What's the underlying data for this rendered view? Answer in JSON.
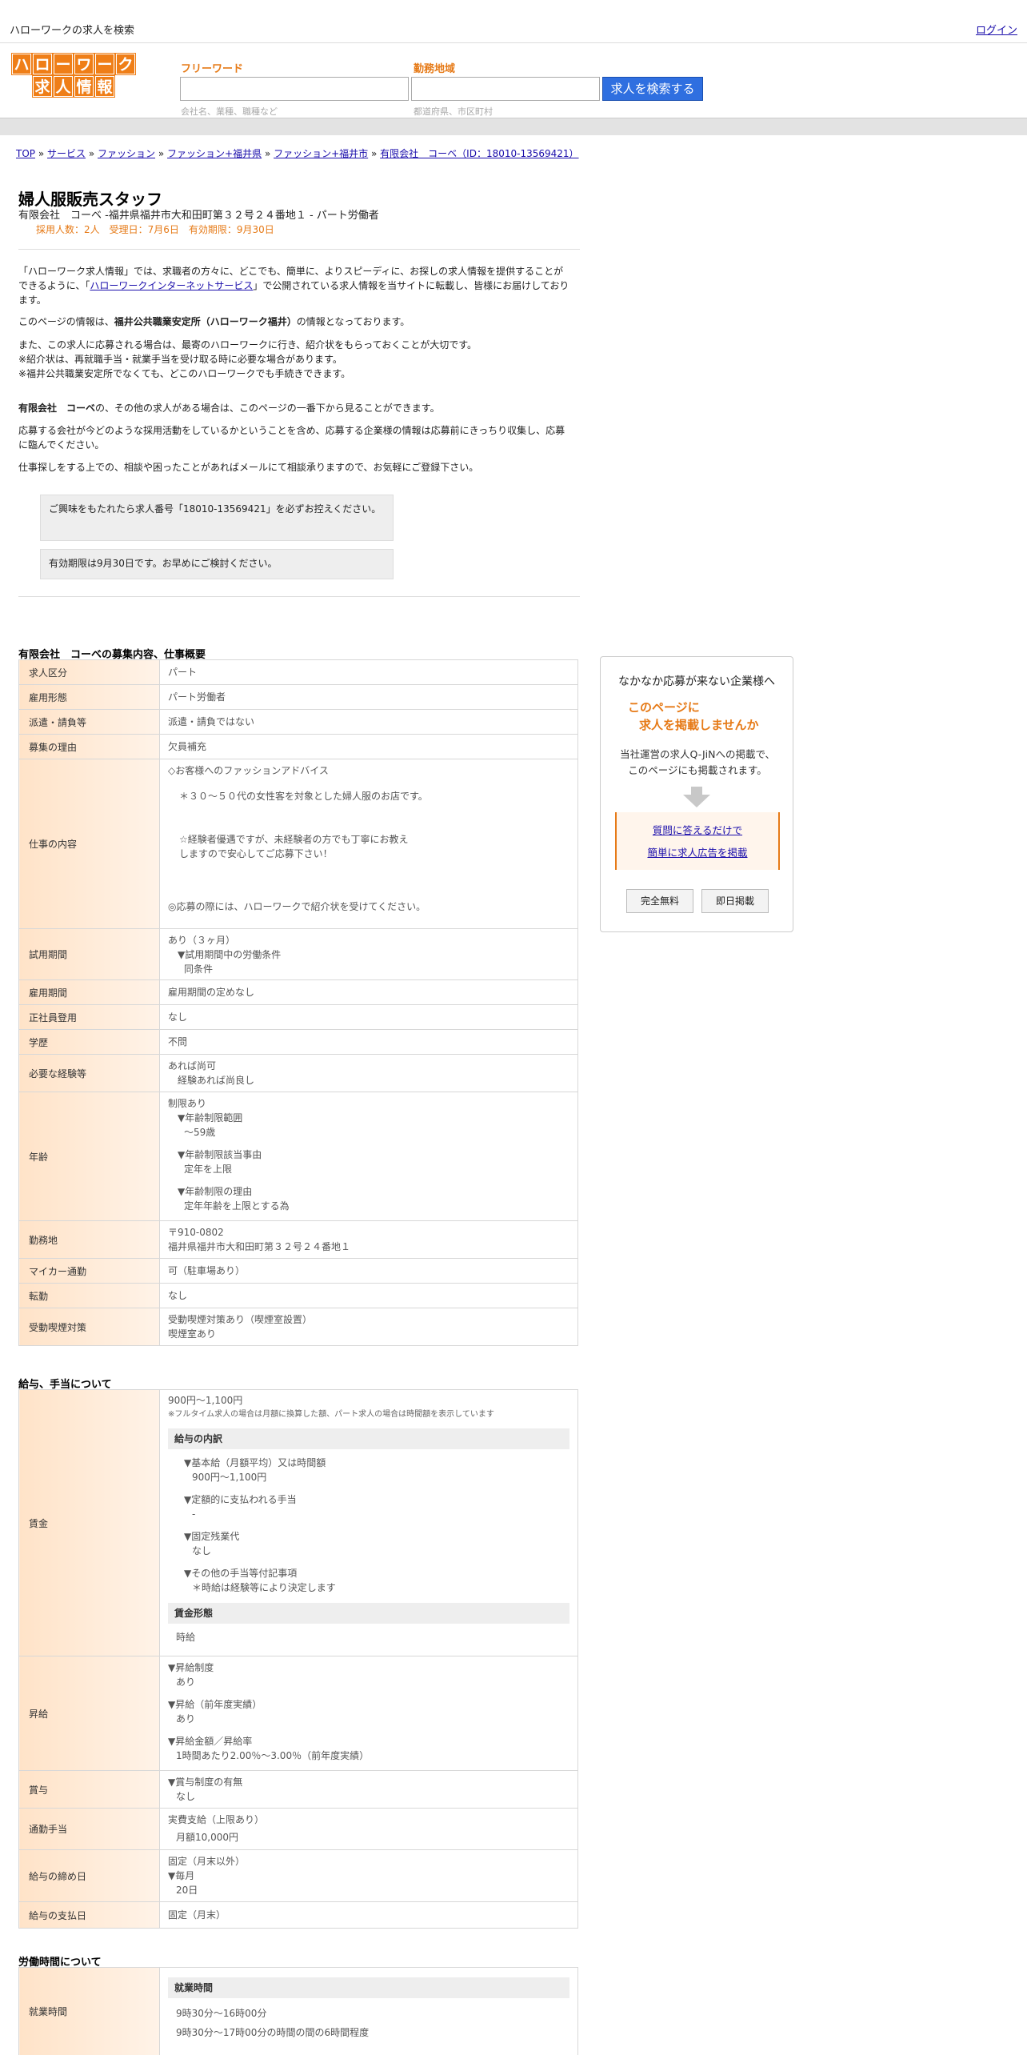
{
  "topbar": {
    "site_title": "ハローワークの求人を検索",
    "login": "ログイン"
  },
  "logo": {
    "row1": [
      "ハ",
      "ロ",
      "ー",
      "ワ",
      "ー",
      "ク"
    ],
    "row2": [
      "求",
      "人",
      "情",
      "報"
    ]
  },
  "search": {
    "freeword_label": "フリーワード",
    "freeword_hint": "会社名、業種、職種など",
    "area_label": "勤務地域",
    "area_hint": "都道府県、市区町村",
    "button": "求人を検索する"
  },
  "breadcrumb": {
    "items": [
      "TOP",
      "サービス",
      "ファッション",
      "ファッション+福井県",
      "ファッション+福井市",
      "有限会社　コーベ（ID：18010-13569421）"
    ],
    "sep": "»"
  },
  "job": {
    "title": "婦人服販売スタッフ",
    "subtitle": "有限会社　コーベ -福井県福井市大和田町第３２号２４番地１ - パート労働者",
    "meta": "採用人数：2人　受理日：7月6日　有効期限：9月30日"
  },
  "intro": {
    "p1_pre": "「ハローワーク求人情報」では、求職者の方々に、どこでも、簡単に、よりスピーディに、お探しの求人情報を提供することができるように、「",
    "p1_link": "ハローワークインターネットサービス",
    "p1_post": "」で公開されている求人情報を当サイトに転載し、皆様にお届けしております。",
    "p2_pre": "このページの情報は、",
    "p2_bold": "福井公共職業安定所（ハローワーク福井）",
    "p2_post": "の情報となっております。",
    "p3": "また、この求人に応募される場合は、最寄のハローワークに行き、紹介状をもらっておくことが大切です。",
    "p4": "※紹介状は、再就職手当・就業手当を受け取る時に必要な場合があります。",
    "p5": "※福井公共職業安定所でなくても、どこのハローワークでも手続きできます。",
    "p6_bold": "有限会社　コーベ",
    "p6_post": "の、その他の求人がある場合は、このページの一番下から見ることができます。",
    "p7": "応募する会社が今どのような採用活動をしているかということを含め、応募する企業様の情報は応募前にきっちり収集し、応募に臨んでください。",
    "p8": "仕事探しをする上での、相談や困ったことがあればメールにて相談承りますので、お気軽にご登録下さい。"
  },
  "notices": {
    "n1": "ご興味をもたれたら求人番号「18010-13569421」を必ずお控えください。",
    "n2": "有効期限は9月30日です。お早めにご検討ください。"
  },
  "sec1": {
    "title": "有限会社　コーベの募集内容、仕事概要",
    "rows": {
      "kyujin_kubun": {
        "label": "求人区分",
        "value": "パート"
      },
      "koyo_keitai": {
        "label": "雇用形態",
        "value": "パート労働者"
      },
      "haken": {
        "label": "派遣・請負等",
        "value": "派遣・請負ではない"
      },
      "riyu": {
        "label": "募集の理由",
        "value": "欠員補充"
      },
      "shigoto": {
        "label": "仕事の内容",
        "l1": "◇お客様へのファッションアドバイス",
        "l2": "＊３０～５０代の女性客を対象とした婦人服のお店です。",
        "l3": "☆経験者優遇ですが、未経験者の方でも丁寧にお教え",
        "l4": "しますので安心してご応募下さい！",
        "l5": "◎応募の際には、ハローワークで紹介状を受けてください。"
      },
      "shiyo": {
        "label": "試用期間",
        "l1": "あり（３ヶ月）",
        "l2": "▼試用期間中の労働条件",
        "l3": "同条件"
      },
      "koyo_kikan": {
        "label": "雇用期間",
        "value": "雇用期間の定めなし"
      },
      "seishain": {
        "label": "正社員登用",
        "value": "なし"
      },
      "gakureki": {
        "label": "学歴",
        "value": "不問"
      },
      "keiken": {
        "label": "必要な経験等",
        "l1": "あれば尚可",
        "l2": "経験あれば尚良し"
      },
      "nenrei": {
        "label": "年齢",
        "l1": "制限あり",
        "l2": "▼年齢制限範囲",
        "l3": "〜59歳",
        "l4": "▼年齢制限該当事由",
        "l5": "定年を上限",
        "l6": "▼年齢制限の理由",
        "l7": "定年年齢を上限とする為"
      },
      "kinmuchi": {
        "label": "勤務地",
        "l1": "〒910-0802",
        "l2": "福井県福井市大和田町第３２号２４番地１"
      },
      "mycar": {
        "label": "マイカー通勤",
        "value": "可（駐車場あり）"
      },
      "tenkin": {
        "label": "転勤",
        "value": "なし"
      },
      "kitsuen": {
        "label": "受動喫煙対策",
        "l1": "受動喫煙対策あり（喫煙室設置）",
        "l2": "喫煙室あり"
      }
    }
  },
  "sec2": {
    "title": "給与、手当について",
    "chingin": {
      "label": "賃金",
      "amount": "900円〜1,100円",
      "note": "※フルタイム求人の場合は月額に換算した額、パート求人の場合は時間額を表示しています",
      "breakdown_head": "給与の内訳",
      "b1": "▼基本給（月額平均）又は時間額",
      "b2": "900円〜1,100円",
      "b3": "▼定額的に支払われる手当",
      "b4": "-",
      "b5": "▼固定残業代",
      "b6": "なし",
      "b7": "▼その他の手当等付記事項",
      "b8": "＊時給は経験等により決定します",
      "form_head": "賃金形態",
      "form": "時給"
    },
    "shokyu": {
      "label": "昇給",
      "l1": "▼昇給制度",
      "l2": "あり",
      "l3": "▼昇給（前年度実績）",
      "l4": "あり",
      "l5": "▼昇給金額／昇給率",
      "l6": "1時間あたり2.00％〜3.00％（前年度実績）"
    },
    "shoyo": {
      "label": "賞与",
      "l1": "▼賞与制度の有無",
      "l2": "なし"
    },
    "tsukin": {
      "label": "通勤手当",
      "l1": "実費支給（上限あり）",
      "l2": "月額10,000円"
    },
    "shimebi": {
      "label": "給与の締め日",
      "l1": "固定（月末以外）",
      "l2": "▼毎月",
      "l3": "20日"
    },
    "shiharai": {
      "label": "給与の支払日",
      "value": "固定（月末）"
    }
  },
  "sec3": {
    "title": "労働時間について",
    "shugyo": {
      "label": "就業時間",
      "head": "就業時間",
      "l1": "9時30分〜16時00分",
      "l2": "9時30分〜17時00分の時間の間の6時間程度"
    }
  },
  "promo": {
    "title": "なかなか応募が来ない企業様へ",
    "catch1": "このページに",
    "catch2": "求人を掲載しませんか",
    "desc1": "当社運営の求人Q-JiNへの掲載で、",
    "desc2": "このページにも掲載されます。",
    "link1": "質問に答えるだけで",
    "link2": "簡単に求人広告を掲載",
    "btn1": "完全無料",
    "btn2": "即日掲載"
  }
}
